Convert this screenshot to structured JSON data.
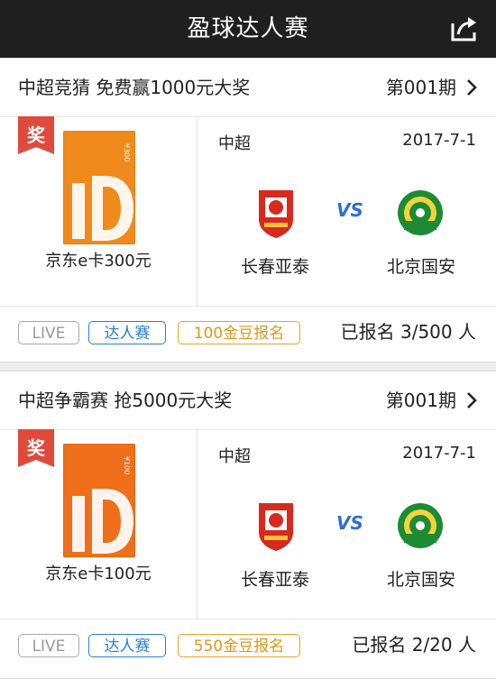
{
  "header": {
    "title": "盈球达人赛",
    "share_icon": "share-icon"
  },
  "colors": {
    "header_bg": "#1f1f1f",
    "vs": "#2f6fd0",
    "tag_blue": "#2a7fd4",
    "tag_gold": "#d89a1c",
    "badge_red": "#e04a3c",
    "card_orange": "#f08a1c"
  },
  "contests": [
    {
      "title": "中超竞猜 免费赢1000元大奖",
      "period": "第001期",
      "prize_badge": "奖",
      "prize_card_amount": "¥300",
      "prize_name": "京东e卡300元",
      "league": "中超",
      "date": "2017-7-1",
      "vs": "VS",
      "home_team": "长春亚泰",
      "away_team": "北京国安",
      "tags": {
        "live": "LIVE",
        "daren": "达人赛",
        "gold": "100金豆报名"
      },
      "signup": "已报名 3/500 人"
    },
    {
      "title": "中超争霸赛 抢5000元大奖",
      "period": "第001期",
      "prize_badge": "奖",
      "prize_card_amount": "¥100",
      "prize_name": "京东e卡100元",
      "league": "中超",
      "date": "2017-7-1",
      "vs": "VS",
      "home_team": "长春亚泰",
      "away_team": "北京国安",
      "tags": {
        "live": "LIVE",
        "daren": "达人赛",
        "gold": "550金豆报名"
      },
      "signup": "已报名 2/20 人"
    }
  ]
}
